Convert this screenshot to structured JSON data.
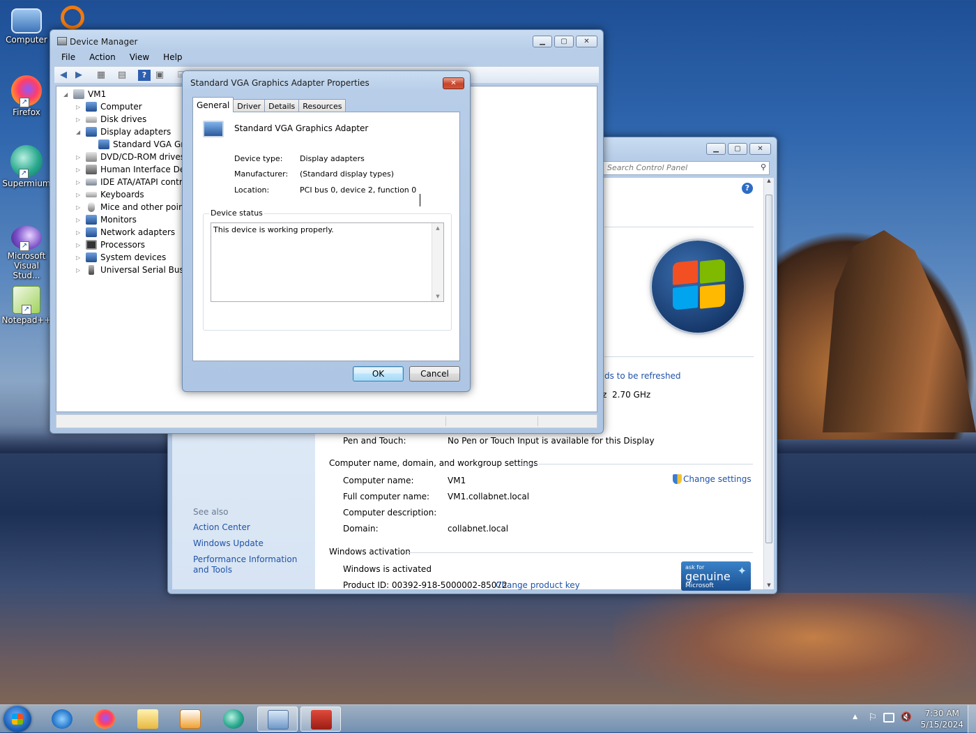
{
  "desktop": {
    "icons": [
      {
        "label": "Computer"
      },
      {
        "label": "Firefox"
      },
      {
        "label": "Supermium"
      },
      {
        "label": "Microsoft Visual Stud..."
      },
      {
        "label": "Notepad++"
      }
    ]
  },
  "system_window": {
    "search_placeholder": "Search Control Panel",
    "see_also": "See also",
    "see_also_links": [
      "Action Center",
      "Windows Update",
      "Performance Information and Tools"
    ],
    "refresh_text": "ds to be refreshed",
    "clock_speed": "2.70 GHz",
    "pen_touch_label": "Pen and Touch:",
    "pen_touch_value": "No Pen or Touch Input is available for this Display",
    "computer_section": "Computer name, domain, and workgroup settings",
    "computer_name_label": "Computer name:",
    "computer_name_value": "VM1",
    "full_name_label": "Full computer name:",
    "full_name_value": "VM1.collabnet.local",
    "description_label": "Computer description:",
    "domain_label": "Domain:",
    "domain_value": "collabnet.local",
    "change_settings": "Change settings",
    "activation_section": "Windows activation",
    "activated_text": "Windows is activated",
    "product_id": "Product ID: 00392-918-5000002-85072",
    "change_key": "Change product key",
    "genuine_top": "ask for",
    "genuine_main": "genuine",
    "genuine_bottom": "Microsoft"
  },
  "device_manager": {
    "title": "Device Manager",
    "menu": [
      "File",
      "Action",
      "View",
      "Help"
    ],
    "tree": {
      "root": "VM1",
      "items": [
        "Computer",
        "Disk drives",
        "Display adapters",
        "Standard VGA Grap",
        "DVD/CD-ROM drives",
        "Human Interface Devic",
        "IDE ATA/ATAPI contro",
        "Keyboards",
        "Mice and other pointin",
        "Monitors",
        "Network adapters",
        "Processors",
        "System devices",
        "Universal Serial Bus co"
      ]
    }
  },
  "properties": {
    "title": "Standard VGA Graphics Adapter Properties",
    "tabs": [
      "General",
      "Driver",
      "Details",
      "Resources"
    ],
    "device_name": "Standard VGA Graphics Adapter",
    "device_type_label": "Device type:",
    "device_type_value": "Display adapters",
    "manufacturer_label": "Manufacturer:",
    "manufacturer_value": "(Standard display types)",
    "location_label": "Location:",
    "location_value": "PCI bus 0, device 2, function 0",
    "status_group": "Device status",
    "status_text": "This device is working properly.",
    "ok": "OK",
    "cancel": "Cancel"
  },
  "taskbar": {
    "time": "7:30 AM",
    "date": "5/15/2024"
  }
}
